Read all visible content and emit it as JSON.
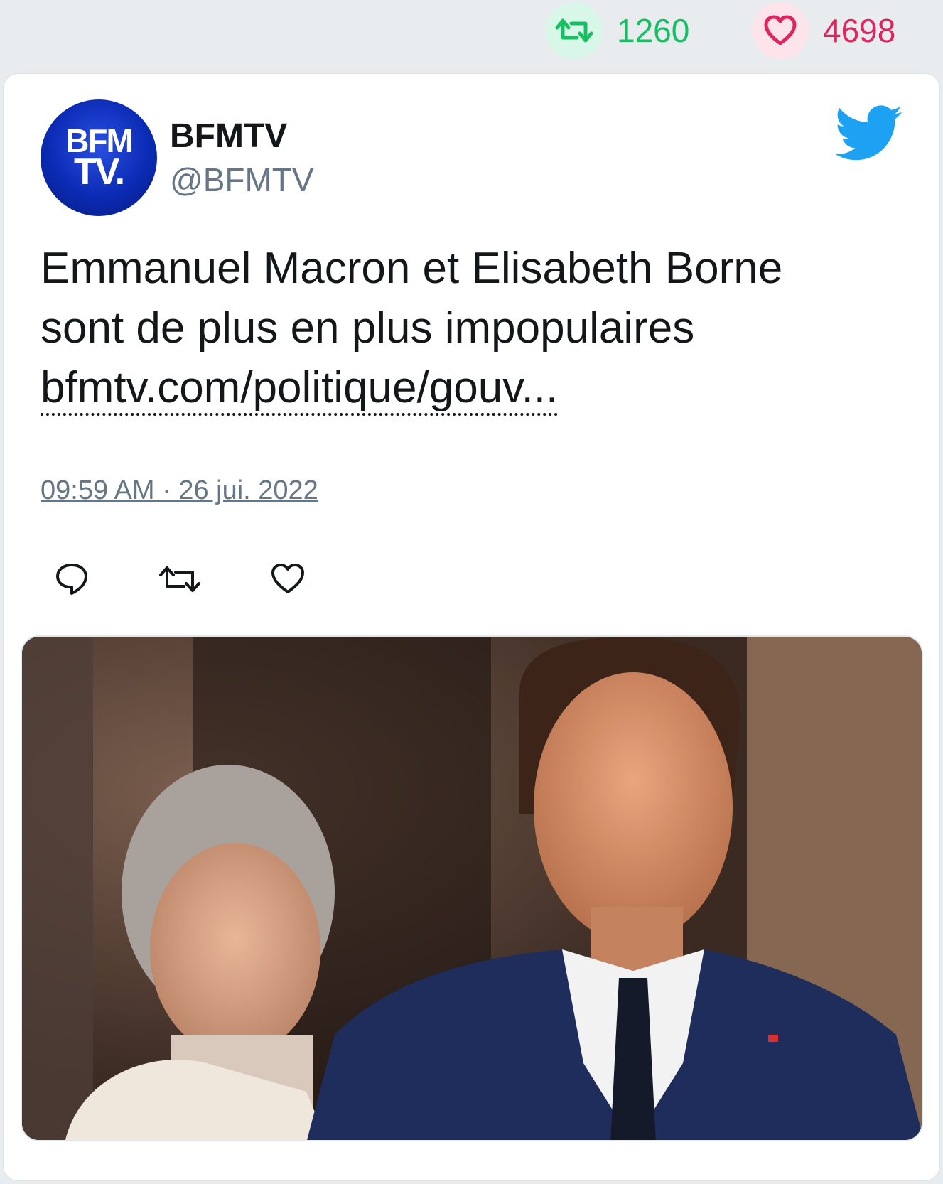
{
  "stats": {
    "retweets": "1260",
    "likes": "4698",
    "retweet_icon": "retweet-icon",
    "like_icon": "heart-icon"
  },
  "tweet": {
    "display_name": "BFMTV",
    "handle": "@BFMTV",
    "avatar_logo_line1": "BFM",
    "avatar_logo_line2": "TV.",
    "text_line1": "Emmanuel Macron et Elisabeth Borne",
    "text_line2": "sont de plus en plus impopulaires",
    "link": "bfmtv.com/politique/gouv...",
    "timestamp": "09:59 AM · 26 jui. 2022"
  },
  "actions": [
    "reply-icon",
    "retweet-icon",
    "like-icon"
  ],
  "colors": {
    "retweet": "#17bf63",
    "like": "#e0245e",
    "twitter_blue": "#1da1f2",
    "muted": "#657786",
    "text": "#14171a"
  }
}
